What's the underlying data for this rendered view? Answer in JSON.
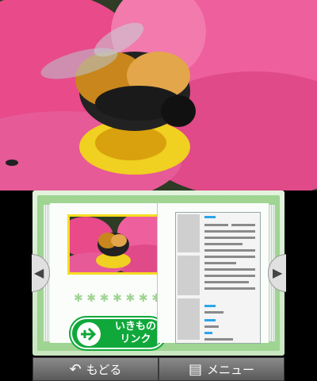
{
  "top_screen": {
    "photo": "bumblebee on pink cosmos flower"
  },
  "bottom_screen": {
    "stars": [
      "✱",
      "✱",
      "✱",
      "✱",
      "✱",
      "✱",
      "✱"
    ],
    "link_button": {
      "line1": "いきもの",
      "line2": "リンク",
      "icon": "branch-arrow-icon"
    },
    "nav": {
      "prev_icon": "◀",
      "next_icon": "▶"
    },
    "bottom_bar": {
      "back_label": "もどる",
      "back_icon": "↶",
      "menu_label": "メニュー",
      "menu_icon": "▤"
    }
  }
}
